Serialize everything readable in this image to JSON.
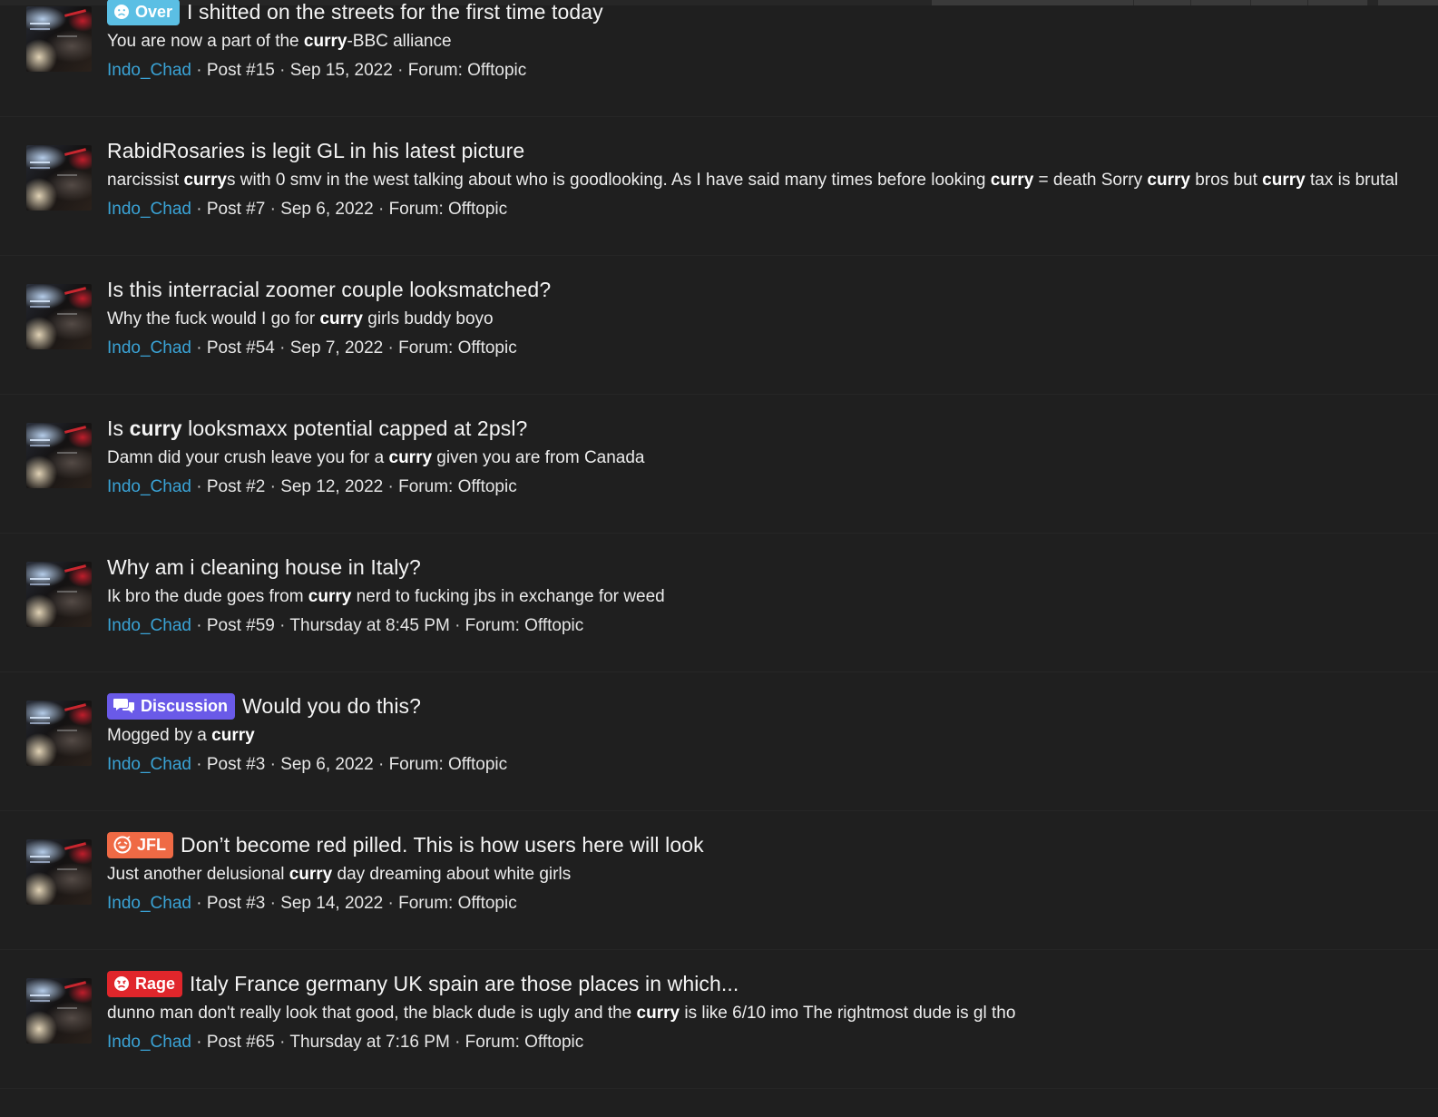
{
  "colors": {
    "background": "#1f1f1f",
    "username": "#3aa3d6",
    "prefix_over": "#5bbfe4",
    "prefix_discussion": "#6a5ae8",
    "prefix_jfl": "#ef6a45",
    "prefix_rage": "#e0262b"
  },
  "separator": "·",
  "results": [
    {
      "prefix": {
        "label": "Over",
        "icon": "frown-face-icon",
        "color": "#5bbfe4"
      },
      "title": [
        {
          "t": "I shitted on the streets for the first time today",
          "b": false
        }
      ],
      "snippet": [
        {
          "t": "You are now a part of the ",
          "b": false
        },
        {
          "t": "curry",
          "b": true
        },
        {
          "t": "-BBC alliance",
          "b": false
        }
      ],
      "author": "Indo_Chad",
      "post": "Post #15",
      "date": "Sep 15, 2022",
      "forum": "Forum: Offtopic"
    },
    {
      "prefix": null,
      "title": [
        {
          "t": "RabidRosaries is legit GL in his latest picture",
          "b": false
        }
      ],
      "snippet": [
        {
          "t": "narcissist ",
          "b": false
        },
        {
          "t": "curry",
          "b": true
        },
        {
          "t": "s with 0 smv in the west talking about who is goodlooking. As I have said many times before looking ",
          "b": false
        },
        {
          "t": "curry",
          "b": true
        },
        {
          "t": " = death Sorry ",
          "b": false
        },
        {
          "t": "curry",
          "b": true
        },
        {
          "t": " bros but ",
          "b": false
        },
        {
          "t": "curry",
          "b": true
        },
        {
          "t": " tax is brutal",
          "b": false
        }
      ],
      "author": "Indo_Chad",
      "post": "Post #7",
      "date": "Sep 6, 2022",
      "forum": "Forum: Offtopic"
    },
    {
      "prefix": null,
      "title": [
        {
          "t": "Is this interracial zoomer couple looksmatched?",
          "b": false
        }
      ],
      "snippet": [
        {
          "t": "Why the fuck would I go for ",
          "b": false
        },
        {
          "t": "curry",
          "b": true
        },
        {
          "t": " girls buddy boyo",
          "b": false
        }
      ],
      "author": "Indo_Chad",
      "post": "Post #54",
      "date": "Sep 7, 2022",
      "forum": "Forum: Offtopic"
    },
    {
      "prefix": null,
      "title": [
        {
          "t": "Is ",
          "b": false
        },
        {
          "t": "curry",
          "b": true
        },
        {
          "t": " looksmaxx potential capped at 2psl?",
          "b": false
        }
      ],
      "snippet": [
        {
          "t": "Damn did your crush leave you for a ",
          "b": false
        },
        {
          "t": "curry",
          "b": true
        },
        {
          "t": " given you are from Canada",
          "b": false
        }
      ],
      "author": "Indo_Chad",
      "post": "Post #2",
      "date": "Sep 12, 2022",
      "forum": "Forum: Offtopic"
    },
    {
      "prefix": null,
      "title": [
        {
          "t": "Why am i cleaning house in Italy?",
          "b": false
        }
      ],
      "snippet": [
        {
          "t": "Ik bro the dude goes from ",
          "b": false
        },
        {
          "t": "curry",
          "b": true
        },
        {
          "t": " nerd to fucking jbs in exchange for weed",
          "b": false
        }
      ],
      "author": "Indo_Chad",
      "post": "Post #59",
      "date": "Thursday at 8:45 PM",
      "forum": "Forum: Offtopic"
    },
    {
      "prefix": {
        "label": "Discussion",
        "icon": "chat-bubbles-icon",
        "color": "#6a5ae8"
      },
      "title": [
        {
          "t": "Would you do this?",
          "b": false
        }
      ],
      "snippet": [
        {
          "t": "Mogged by a ",
          "b": false
        },
        {
          "t": "curry",
          "b": true
        }
      ],
      "author": "Indo_Chad",
      "post": "Post #3",
      "date": "Sep 6, 2022",
      "forum": "Forum: Offtopic"
    },
    {
      "prefix": {
        "label": "JFL",
        "icon": "laughing-face-icon",
        "color": "#ef6a45"
      },
      "title": [
        {
          "t": "Don’t become red pilled. This is how users here will look",
          "b": false
        }
      ],
      "snippet": [
        {
          "t": "Just another delusional ",
          "b": false
        },
        {
          "t": "curry",
          "b": true
        },
        {
          "t": " day dreaming about white girls",
          "b": false
        }
      ],
      "author": "Indo_Chad",
      "post": "Post #3",
      "date": "Sep 14, 2022",
      "forum": "Forum: Offtopic"
    },
    {
      "prefix": {
        "label": "Rage",
        "icon": "angry-face-icon",
        "color": "#e0262b"
      },
      "title": [
        {
          "t": "Italy France germany UK spain are those places in which...",
          "b": false
        }
      ],
      "snippet": [
        {
          "t": "dunno man don't really look that good, the black dude is ugly and the ",
          "b": false
        },
        {
          "t": "curry",
          "b": true
        },
        {
          "t": " is like 6/10 imo The rightmost dude is gl tho",
          "b": false
        }
      ],
      "author": "Indo_Chad",
      "post": "Post #65",
      "date": "Thursday at 7:16 PM",
      "forum": "Forum: Offtopic"
    }
  ]
}
